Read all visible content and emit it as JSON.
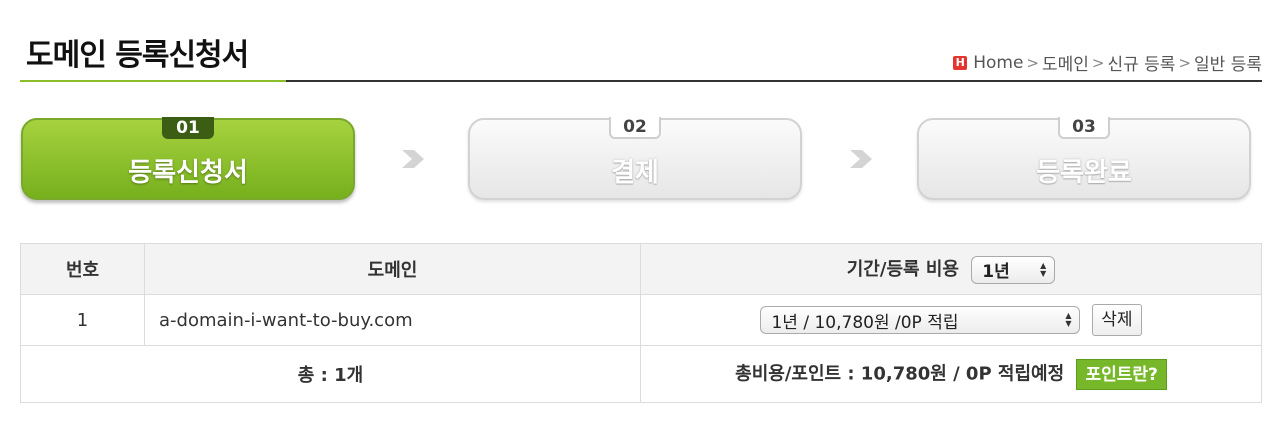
{
  "header": {
    "title": "도메인 등록신청서",
    "breadcrumb": {
      "home_icon_letter": "H",
      "home": "Home",
      "items": [
        "도메인",
        "신규 등록",
        "일반 등록"
      ]
    }
  },
  "steps": [
    {
      "number": "01",
      "label": "등록신청서",
      "active": true
    },
    {
      "number": "02",
      "label": "결제",
      "active": false
    },
    {
      "number": "03",
      "label": "등록완료",
      "active": false
    }
  ],
  "table": {
    "headers": {
      "no": "번호",
      "domain": "도메인",
      "period": "기간/등록 비용",
      "period_select": "1년"
    },
    "rows": [
      {
        "no": "1",
        "domain": "a-domain-i-want-to-buy.com",
        "price_select": "1년 / 10,780원 /0P 적립",
        "delete_label": "삭제"
      }
    ],
    "footer": {
      "total_count": "총 : 1개",
      "total_cost": "총비용/포인트 : 10,780원 / 0P 적립예정",
      "point_button": "포인트란?"
    }
  },
  "colors": {
    "accent_green": "#77b01d",
    "point_button": "#77b72a",
    "home_icon": "#e3342f"
  }
}
